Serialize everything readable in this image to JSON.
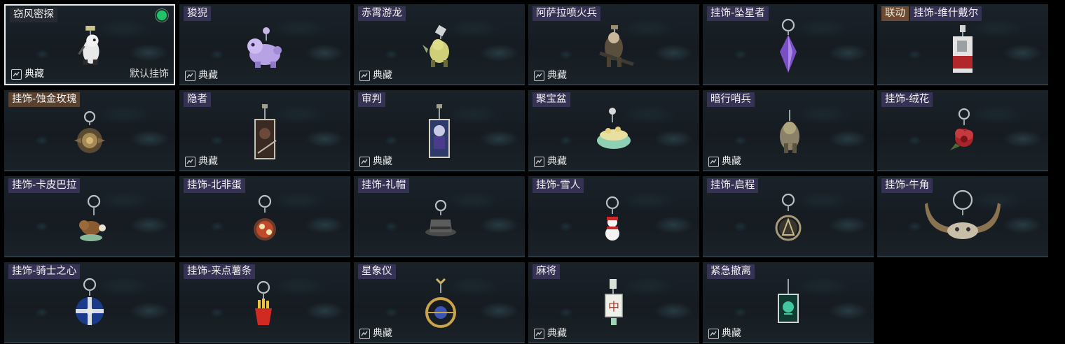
{
  "labels": {
    "collect": "典藏",
    "default": "默认挂饰",
    "linkage": "联动"
  },
  "colors": {
    "selected_border": "#e8ecef",
    "status_active": "#22c26a",
    "name_tag_bg": "#383458",
    "linkage_tag_bg": "#704c34"
  },
  "items": [
    {
      "name": "窃风密探",
      "collect": true,
      "default": true,
      "selected": true,
      "equipped": true,
      "icon": "spy-charm-icon",
      "tag": "dark"
    },
    {
      "name": "狻猊",
      "collect": true,
      "icon": "lion-charm-icon"
    },
    {
      "name": "赤霄游龙",
      "collect": true,
      "icon": "dragon-charm-icon"
    },
    {
      "name": "阿萨拉喷火兵",
      "collect": true,
      "icon": "flamethrower-soldier-charm-icon"
    },
    {
      "name": "挂饰-坠星者",
      "icon": "purple-crystal-charm-icon"
    },
    {
      "name": "挂饰-维什戴尔",
      "linkage": true,
      "icon": "card-keychain-charm-icon"
    },
    {
      "name": "挂饰-蚀金玫瑰",
      "icon": "gold-rose-charm-icon",
      "tag": "gold"
    },
    {
      "name": "隐者",
      "collect": true,
      "icon": "hermit-card-charm-icon"
    },
    {
      "name": "审判",
      "collect": true,
      "icon": "judgement-card-charm-icon"
    },
    {
      "name": "聚宝盆",
      "collect": true,
      "icon": "treasure-bowl-charm-icon"
    },
    {
      "name": "暗行哨兵",
      "collect": true,
      "icon": "sentinel-charm-icon"
    },
    {
      "name": "挂饰-绒花",
      "icon": "red-flower-charm-icon"
    },
    {
      "name": "挂饰-卡皮巴拉",
      "icon": "capybara-charm-icon"
    },
    {
      "name": "挂饰-北非蛋",
      "icon": "shakshuka-charm-icon"
    },
    {
      "name": "挂饰-礼帽",
      "icon": "top-hat-charm-icon"
    },
    {
      "name": "挂饰-雪人",
      "icon": "snowman-charm-icon"
    },
    {
      "name": "挂饰-启程",
      "icon": "compass-medal-charm-icon"
    },
    {
      "name": "挂饰-牛角",
      "icon": "bull-horns-charm-icon"
    },
    {
      "name": "挂饰-骑士之心",
      "icon": "knight-shield-charm-icon"
    },
    {
      "name": "挂饰-来点薯条",
      "icon": "french-fries-charm-icon"
    },
    {
      "name": "星象仪",
      "collect": true,
      "icon": "astrolabe-charm-icon"
    },
    {
      "name": "麻将",
      "collect": true,
      "icon": "mahjong-tile-charm-icon"
    },
    {
      "name": "紧急撤离",
      "collect": true,
      "icon": "green-keycard-charm-icon"
    }
  ]
}
